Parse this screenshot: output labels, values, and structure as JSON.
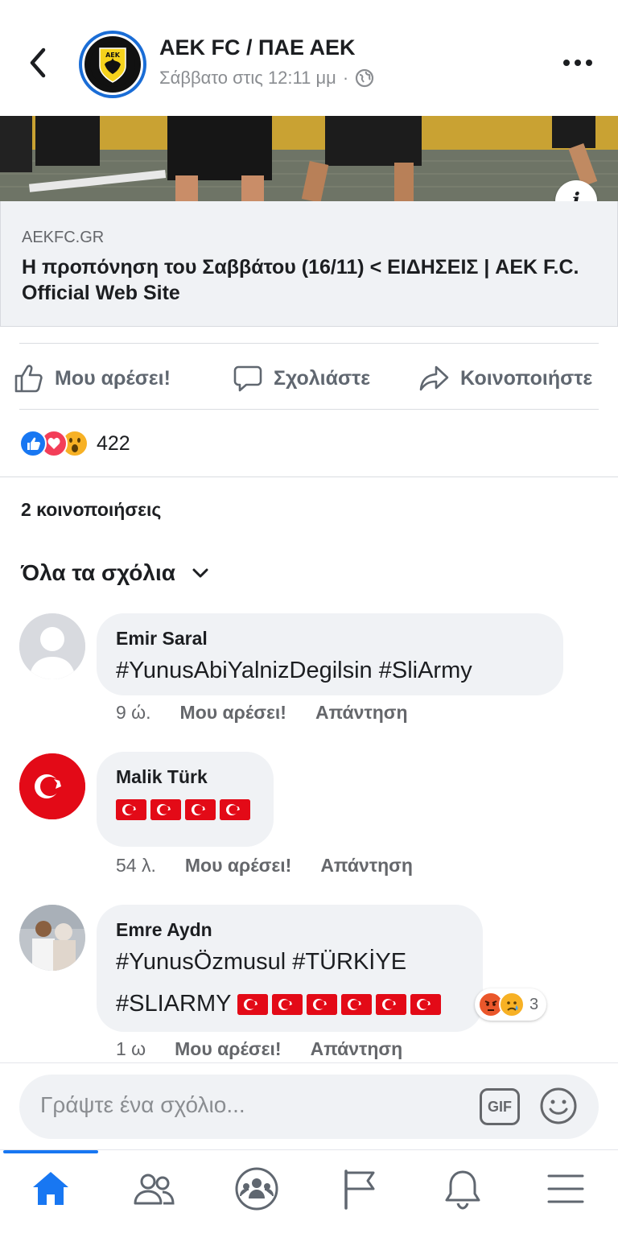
{
  "header": {
    "page_name": "AEK FC / ΠΑΕ ΑΕΚ",
    "timestamp": "Σάββατο στις 12:11 μμ",
    "separator": "·",
    "avatar_text": "ΑΕΚ"
  },
  "link_preview": {
    "domain": "AEKFC.GR",
    "title": "Η προπόνηση του Σαββάτου (16/11) < ΕΙΔΗΣΕΙΣ | AEK F.C. Official Web Site",
    "info_label": "i"
  },
  "actions": {
    "like": "Μου αρέσει!",
    "comment": "Σχολιάστε",
    "share": "Κοινοποιήστε"
  },
  "reactions": {
    "count": "422",
    "types": [
      "like",
      "love",
      "wow"
    ]
  },
  "shares_text": "2 κοινοποιήσεις",
  "comments_filter": "Όλα τα σχόλια",
  "comments": [
    {
      "author": "Emir Saral",
      "text": "#YunusAbiYalnizDegilsin #SliArmy",
      "time": "9 ώ.",
      "like": "Μου αρέσει!",
      "reply": "Απάντηση"
    },
    {
      "author": "Malik Türk",
      "flags": 4,
      "time": "54 λ.",
      "like": "Μου αρέσει!",
      "reply": "Απάντηση"
    },
    {
      "author": "Emre Aydn",
      "text_line1": "#YunusÖzmusul #TÜRKİYE",
      "text_line2": "#SLIARMY",
      "flags": 6,
      "reaction_count": "3",
      "reaction_types": [
        "angry",
        "sad"
      ],
      "time": "1 ω",
      "like": "Μου αρέσει!",
      "reply": "Απάντηση"
    }
  ],
  "composer": {
    "placeholder": "Γράψτε ένα σχόλιο...",
    "gif_label": "GIF"
  },
  "colors": {
    "accent": "#1877f2",
    "turkish_red": "#e30a17"
  }
}
